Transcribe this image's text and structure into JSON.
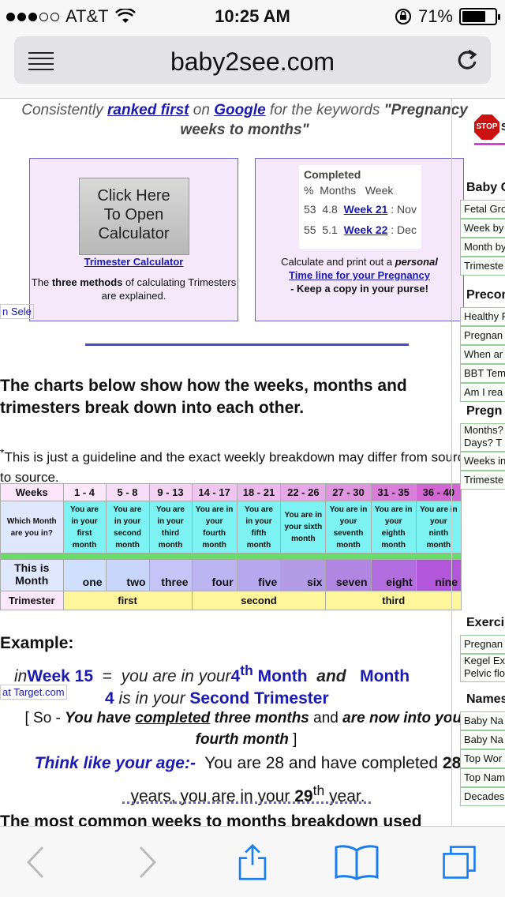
{
  "status_bar": {
    "carrier": "AT&T",
    "time": "10:25 AM",
    "battery": "71%",
    "battery_level": 0.71
  },
  "browser": {
    "url": "baby2see.com"
  },
  "intro": {
    "prefix": "Consistently",
    "link1": "ranked first",
    "mid": "on",
    "link2": "Google",
    "suffix": "for the keywords",
    "keyword": "\"Pregnancy weeks to months\""
  },
  "calculator_box": {
    "image_text_1": "Click Here",
    "image_text_2": "To Open",
    "image_text_3": "Calculator",
    "link": "Trimester Calculator",
    "desc_prefix": "The",
    "desc_bold": "three methods",
    "desc_suffix": "of calculating Trimesters are explained."
  },
  "timeline_box": {
    "sheet_title": "Completed",
    "col_pct": "%",
    "col_months": "Months",
    "col_week": "Week",
    "row1_pct": "53",
    "row1_months": "4.8",
    "row1_week": "Week 21",
    "row1_rest": ": Nov",
    "row2_pct": "55",
    "row2_months": "5.1",
    "row2_week": "Week 22",
    "row2_rest": ": Dec",
    "desc_prefix": "Calculate and print out a",
    "desc_em": "personal",
    "link": "Time line for your Pregnancy",
    "tagline": "- Keep a copy in your purse!"
  },
  "partial_left_text": "n Sele",
  "heading": "The charts below show how the weeks, months and trimesters break down into each other.",
  "note": "This is just a guideline and the exact weekly breakdown may differ from source to source.",
  "chart_data": {
    "type": "table",
    "row_labels": {
      "weeks": "Weeks",
      "which_month": "Which Month are you in?",
      "this_is_month": "This is Month",
      "trimester": "Trimester"
    },
    "weeks": [
      "1 - 4",
      "5 - 8",
      "9 - 13",
      "14 - 17",
      "18 - 21",
      "22 - 26",
      "27 - 30",
      "31 - 35",
      "36 - 40"
    ],
    "you_are_in": [
      "You are in your first month",
      "You are in your second month",
      "You are in your third month",
      "You are in your fourth month",
      "You are in your fifth month",
      "You are in your sixth month",
      "You are in your seventh month",
      "You are in your eighth month",
      "You are in your ninth month"
    ],
    "months": [
      "one",
      "two",
      "three",
      "four",
      "five",
      "six",
      "seven",
      "eight",
      "nine"
    ],
    "trimesters": [
      "first",
      "second",
      "third"
    ],
    "colors": {
      "weeks_bg": [
        "#fbe6fb",
        "#f8ddf8",
        "#f4d2f4",
        "#f0c6f0",
        "#ecbaec",
        "#e6a8e6",
        "#df96df",
        "#d97fd9",
        "#d366d3"
      ],
      "header_label_bg": "#fbe6fb",
      "month_bg": "#7df2f2",
      "month_label_bg": "#e0e8ff",
      "this_month_bg": [
        "#cfe0ff",
        "#c8d6fb",
        "#c4c4f6",
        "#bdb4f2",
        "#b5a8ee",
        "#b49be8",
        "#b186e3",
        "#b26ede",
        "#b256da"
      ],
      "trimester_bg": "#fff59b",
      "separator": "#66dd66"
    }
  },
  "example": {
    "title": "Example:",
    "in_word": "in",
    "week": "Week 15",
    "equals": "=",
    "you_are": "you are in your",
    "month_num": "4",
    "month_sup": "th",
    "month_word": "Month",
    "and": "and",
    "month_label": "Month",
    "month_4": "4",
    "is_in_your": "is in your",
    "trimester": "Second Trimester",
    "target_text": "at Target.com",
    "so_prefix": "[ So -",
    "so_bold1": "You have",
    "so_completed": "completed",
    "so_bold2": "three months",
    "so_and": "and",
    "so_bold3": "are now into your fourth month",
    "so_end": "]",
    "think": "Think like your age:-",
    "age_text1": "You are 28 and have completed",
    "age_num1": "28",
    "age_text2": "years, you are in your",
    "age_num2": "29",
    "age_sup": "th",
    "age_text3": "year.",
    "cut_heading": "The most common weeks to months breakdown used"
  },
  "sidebar": {
    "stop_text": "STOP",
    "stop_partial": "S",
    "sections": [
      {
        "title": "Baby G",
        "items": [
          "Fetal Gro",
          "Week by",
          "Month by",
          "Trimeste"
        ]
      },
      {
        "title": "Precon",
        "items": [
          "Healthy F",
          "Pregnan",
          "When ar",
          "BBT Tem",
          "Am I rea"
        ]
      },
      {
        "title": "Pregn",
        "items": [
          "Months? Days? T",
          "Weeks in",
          "Trimeste"
        ]
      },
      {
        "title": "Exerci",
        "items": [
          "Pregnan",
          "Kegel Ex Pelvic flo"
        ]
      },
      {
        "title": "Names",
        "items": [
          "Baby Na",
          "Baby Na",
          "Top Wor",
          "Top Nam",
          "Decades"
        ]
      }
    ]
  }
}
